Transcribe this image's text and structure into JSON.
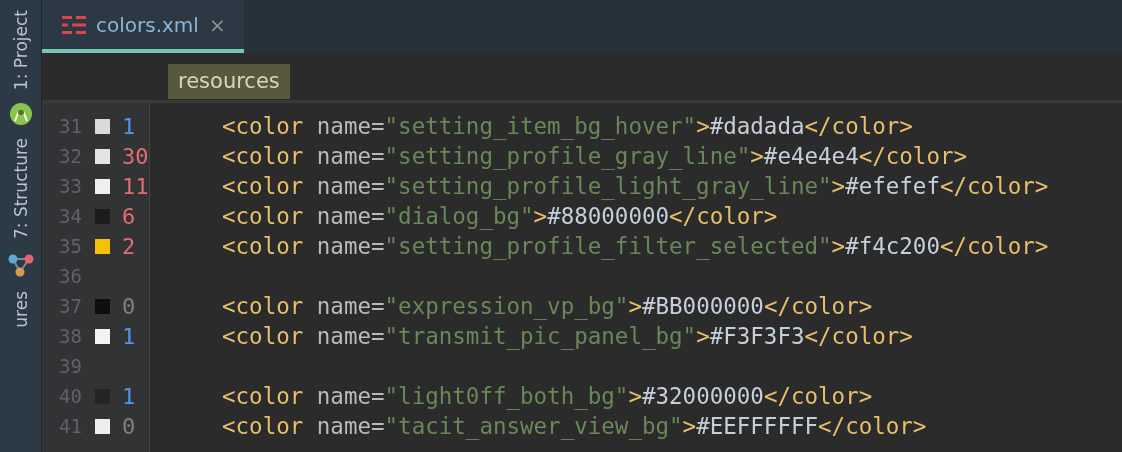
{
  "sidebar": {
    "items": [
      {
        "label": "1: Project"
      },
      {
        "label": "7: Structure"
      },
      {
        "label": "ures"
      }
    ]
  },
  "tabs": [
    {
      "label": "colors.xml",
      "selected": true,
      "close": "×"
    }
  ],
  "breadcrumb": [
    "resources"
  ],
  "lines": [
    {
      "number": "31",
      "swatch": {
        "color": "#dadada"
      },
      "count": {
        "text": "1",
        "color": "#5394ec"
      },
      "code": "<color name=\"setting_item_bg_hover\">#dadada</color>"
    },
    {
      "number": "32",
      "swatch": {
        "color": "#e4e4e4"
      },
      "count": {
        "text": "30",
        "color": "#e06c75"
      },
      "code": "<color name=\"setting_profile_gray_line\">#e4e4e4</color>"
    },
    {
      "number": "33",
      "swatch": {
        "color": "#efefef"
      },
      "count": {
        "text": "11",
        "color": "#e06c75"
      },
      "code": "<color name=\"setting_profile_light_gray_line\">#efefef</color>"
    },
    {
      "number": "34",
      "swatch": {
        "color": "#1c1c1c"
      },
      "count": {
        "text": "6",
        "color": "#e06c75"
      },
      "code": "<color name=\"dialog_bg\">#88000000</color>"
    },
    {
      "number": "35",
      "swatch": {
        "color": "#f4c200"
      },
      "count": {
        "text": "2",
        "color": "#e06c75"
      },
      "code": "<color name=\"setting_profile_filter_selected\">#f4c200</color>"
    },
    {
      "number": "36"
    },
    {
      "number": "37",
      "swatch": {
        "color": "#0e0e0e"
      },
      "count": {
        "text": "0",
        "color": "#808080"
      },
      "code": "<color name=\"expression_vp_bg\">#BB000000</color>"
    },
    {
      "number": "38",
      "swatch": {
        "color": "#f3f3f3"
      },
      "count": {
        "text": "1",
        "color": "#5394ec"
      },
      "code": "<color name=\"transmit_pic_panel_bg\">#F3F3F3</color>"
    },
    {
      "number": "39"
    },
    {
      "number": "40",
      "swatch": {
        "color": "#242424"
      },
      "count": {
        "text": "1",
        "color": "#5394ec"
      },
      "code": "<color name=\"light0ff_both_bg\">#32000000</color>"
    },
    {
      "number": "41",
      "swatch": {
        "color": "#eeeeee"
      },
      "count": {
        "text": "0",
        "color": "#808080"
      },
      "code": "<color name=\"tacit_answer_view_bg\">#EEFFFFFF</color>"
    }
  ]
}
